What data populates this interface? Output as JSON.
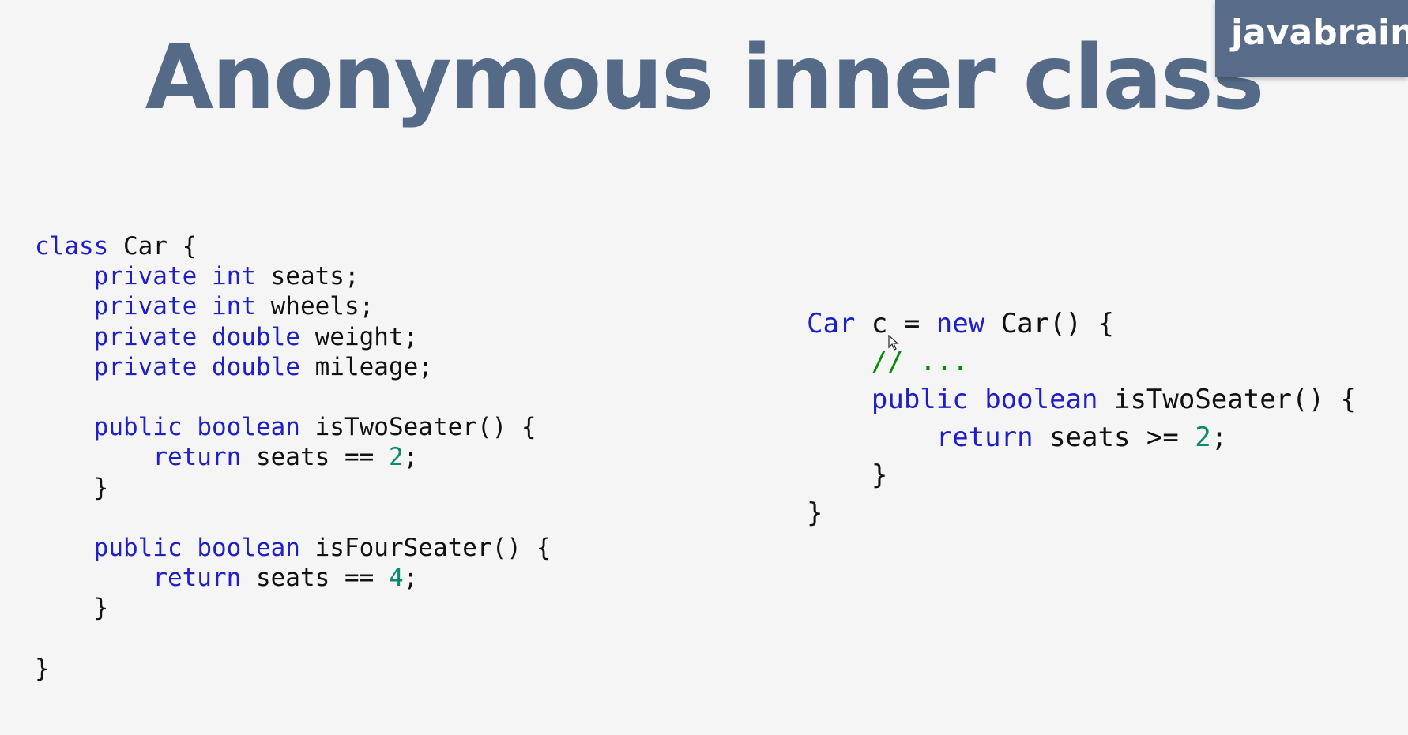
{
  "slide": {
    "title": "Anonymous inner class",
    "brand": "javabrains"
  },
  "code_left": {
    "lines": [
      [
        {
          "t": "class",
          "k": "kw"
        },
        {
          "t": " Car {",
          "k": ""
        }
      ],
      [
        {
          "t": "    ",
          "k": ""
        },
        {
          "t": "private",
          "k": "kw"
        },
        {
          "t": " ",
          "k": ""
        },
        {
          "t": "int",
          "k": "kw"
        },
        {
          "t": " seats;",
          "k": ""
        }
      ],
      [
        {
          "t": "    ",
          "k": ""
        },
        {
          "t": "private",
          "k": "kw"
        },
        {
          "t": " ",
          "k": ""
        },
        {
          "t": "int",
          "k": "kw"
        },
        {
          "t": " wheels;",
          "k": ""
        }
      ],
      [
        {
          "t": "    ",
          "k": ""
        },
        {
          "t": "private",
          "k": "kw"
        },
        {
          "t": " ",
          "k": ""
        },
        {
          "t": "double",
          "k": "kw"
        },
        {
          "t": " weight;",
          "k": ""
        }
      ],
      [
        {
          "t": "    ",
          "k": ""
        },
        {
          "t": "private",
          "k": "kw"
        },
        {
          "t": " ",
          "k": ""
        },
        {
          "t": "double",
          "k": "kw"
        },
        {
          "t": " mileage;",
          "k": ""
        }
      ],
      [],
      [
        {
          "t": "    ",
          "k": ""
        },
        {
          "t": "public",
          "k": "kw"
        },
        {
          "t": " ",
          "k": ""
        },
        {
          "t": "boolean",
          "k": "kw"
        },
        {
          "t": " isTwoSeater() {",
          "k": ""
        }
      ],
      [
        {
          "t": "        ",
          "k": ""
        },
        {
          "t": "return",
          "k": "kw"
        },
        {
          "t": " seats == ",
          "k": ""
        },
        {
          "t": "2",
          "k": "num"
        },
        {
          "t": ";",
          "k": ""
        }
      ],
      [
        {
          "t": "    }",
          "k": ""
        }
      ],
      [],
      [
        {
          "t": "    ",
          "k": ""
        },
        {
          "t": "public",
          "k": "kw"
        },
        {
          "t": " ",
          "k": ""
        },
        {
          "t": "boolean",
          "k": "kw"
        },
        {
          "t": " isFourSeater() {",
          "k": ""
        }
      ],
      [
        {
          "t": "        ",
          "k": ""
        },
        {
          "t": "return",
          "k": "kw"
        },
        {
          "t": " seats == ",
          "k": ""
        },
        {
          "t": "4",
          "k": "num"
        },
        {
          "t": ";",
          "k": ""
        }
      ],
      [
        {
          "t": "    }",
          "k": ""
        }
      ],
      [],
      [
        {
          "t": "}",
          "k": ""
        }
      ]
    ]
  },
  "code_right": {
    "lines": [
      [
        {
          "t": "Car",
          "k": "kw"
        },
        {
          "t": " c = ",
          "k": ""
        },
        {
          "t": "new",
          "k": "kw"
        },
        {
          "t": " Car() {",
          "k": ""
        }
      ],
      [
        {
          "t": "    ",
          "k": ""
        },
        {
          "t": "// ...",
          "k": "cm"
        }
      ],
      [
        {
          "t": "    ",
          "k": ""
        },
        {
          "t": "public",
          "k": "kw"
        },
        {
          "t": " ",
          "k": ""
        },
        {
          "t": "boolean",
          "k": "kw"
        },
        {
          "t": " isTwoSeater() {",
          "k": ""
        }
      ],
      [
        {
          "t": "        ",
          "k": ""
        },
        {
          "t": "return",
          "k": "kw"
        },
        {
          "t": " seats >= ",
          "k": ""
        },
        {
          "t": "2",
          "k": "num"
        },
        {
          "t": ";",
          "k": ""
        }
      ],
      [
        {
          "t": "    }",
          "k": ""
        }
      ],
      [
        {
          "t": "}",
          "k": ""
        }
      ]
    ]
  },
  "colors": {
    "title": "#546a87",
    "brand_bg": "#586b88",
    "keyword": "#1f1fc7",
    "number": "#0d8a6e",
    "comment": "#0a8a0a",
    "text": "#111111"
  },
  "icons": {
    "cursor": "mouse-pointer-icon"
  }
}
